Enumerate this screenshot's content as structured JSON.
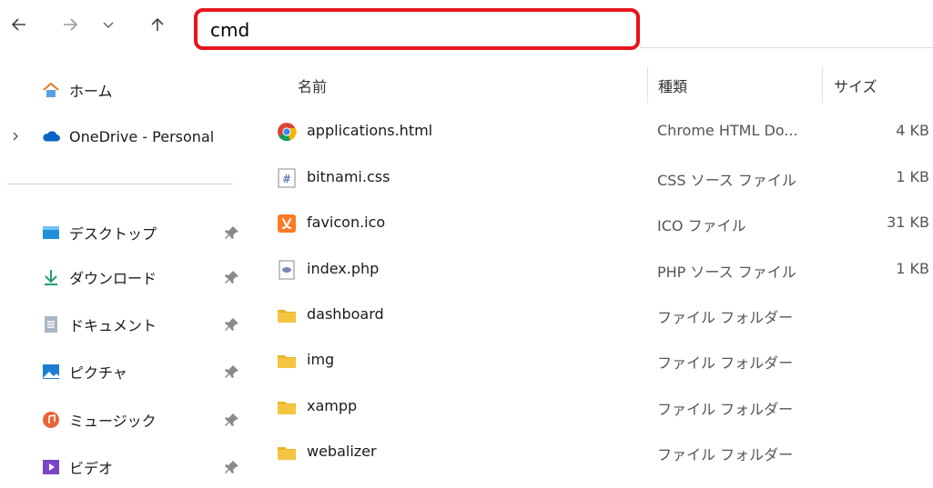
{
  "address_bar": {
    "value": "cmd"
  },
  "sidebar": {
    "items": [
      {
        "label": "ホーム",
        "icon": "home-icon"
      },
      {
        "label": "OneDrive - Personal",
        "icon": "onedrive-cloud-icon"
      },
      {
        "label": "デスクトップ",
        "icon": "desktop-icon"
      },
      {
        "label": "ダウンロード",
        "icon": "download-icon"
      },
      {
        "label": "ドキュメント",
        "icon": "documents-icon"
      },
      {
        "label": "ピクチャ",
        "icon": "pictures-icon"
      },
      {
        "label": "ミュージック",
        "icon": "music-icon"
      },
      {
        "label": "ビデオ",
        "icon": "video-icon"
      }
    ]
  },
  "columns": {
    "name": "名前",
    "type": "種類",
    "size": "サイズ"
  },
  "files": [
    {
      "name": "applications.html",
      "type": "Chrome HTML Do...",
      "size": "4 KB",
      "icon": "chrome-icon"
    },
    {
      "name": "bitnami.css",
      "type": "CSS ソース ファイル",
      "size": "1 KB",
      "icon": "css-file-icon"
    },
    {
      "name": "favicon.ico",
      "type": "ICO ファイル",
      "size": "31 KB",
      "icon": "xampp-icon"
    },
    {
      "name": "index.php",
      "type": "PHP ソース ファイル",
      "size": "1 KB",
      "icon": "php-file-icon"
    },
    {
      "name": "dashboard",
      "type": "ファイル フォルダー",
      "size": "",
      "icon": "folder-icon"
    },
    {
      "name": "img",
      "type": "ファイル フォルダー",
      "size": "",
      "icon": "folder-icon"
    },
    {
      "name": "xampp",
      "type": "ファイル フォルダー",
      "size": "",
      "icon": "folder-icon"
    },
    {
      "name": "webalizer",
      "type": "ファイル フォルダー",
      "size": "",
      "icon": "folder-icon"
    }
  ],
  "colors": {
    "highlight_border": "#e8141c",
    "folder": "#f5c542",
    "onedrive": "#0a64c8"
  }
}
